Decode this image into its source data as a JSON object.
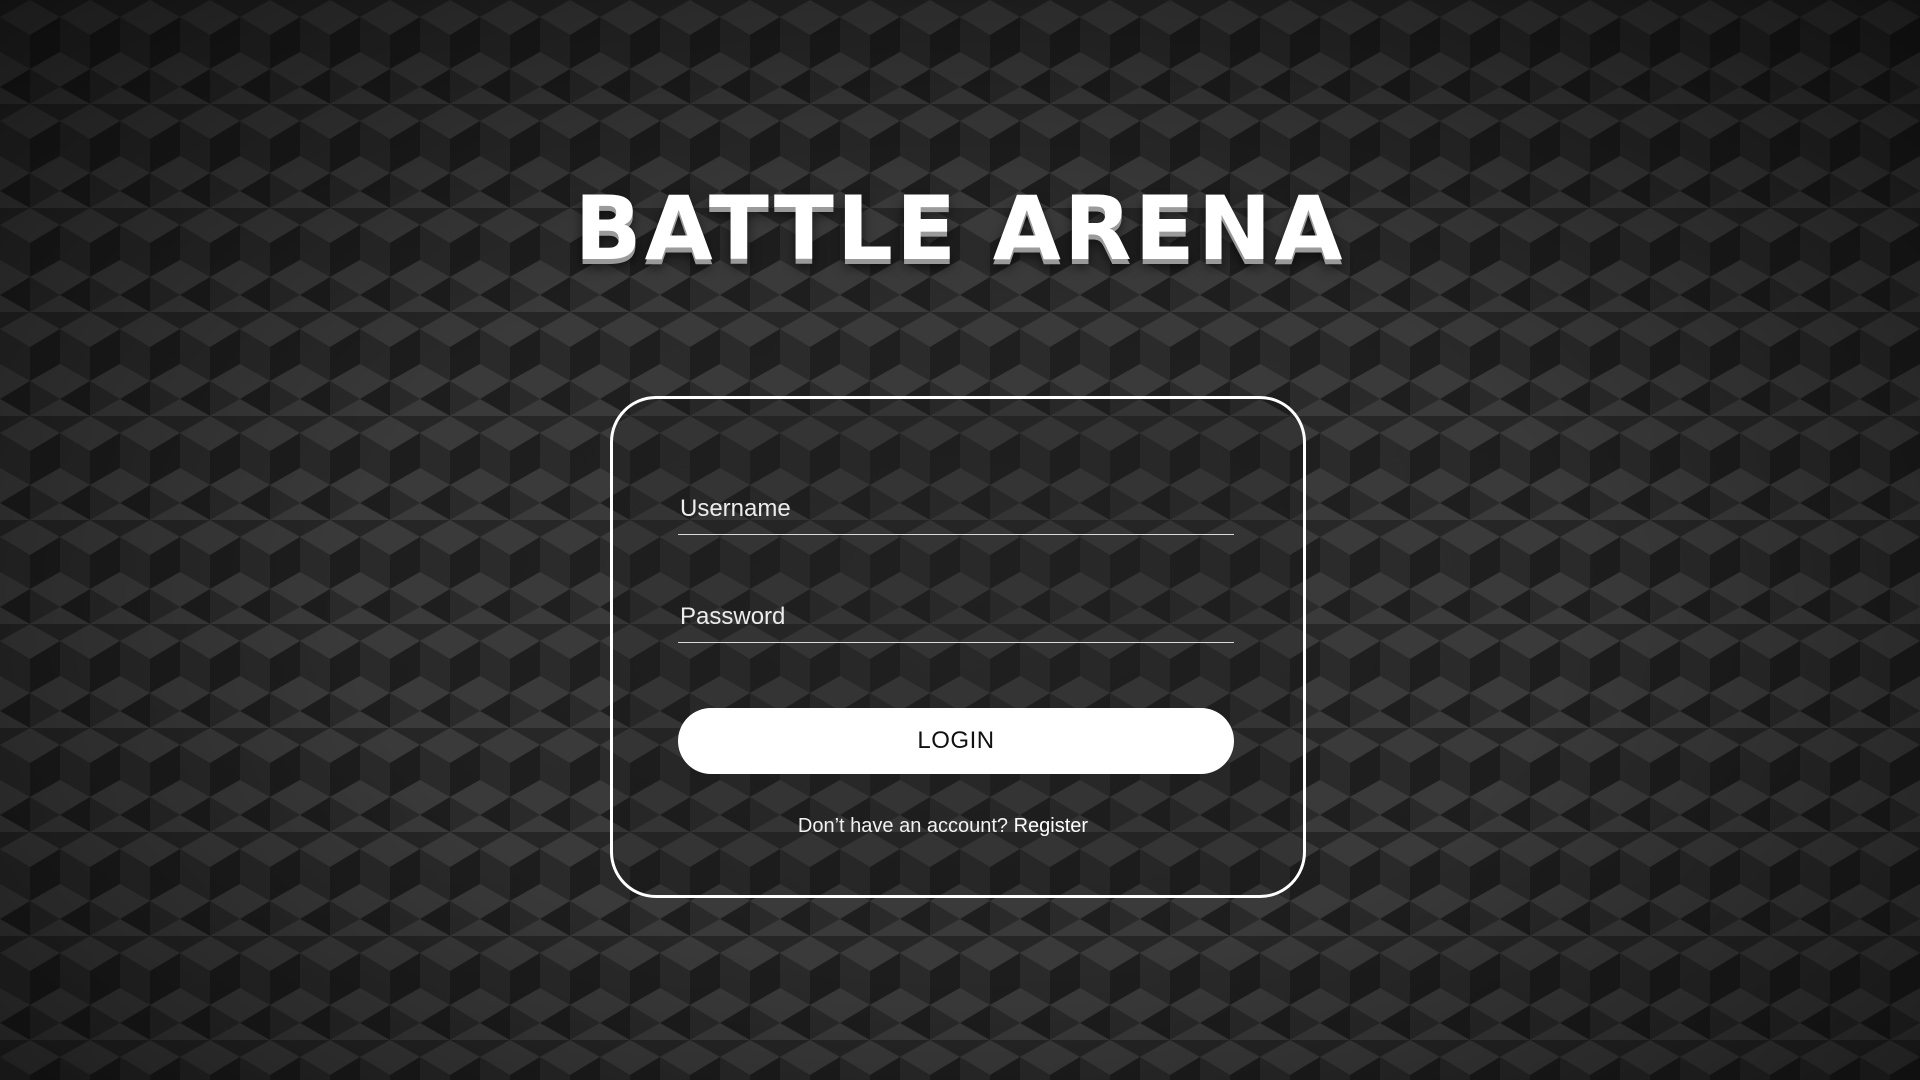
{
  "app": {
    "title": "BATTLE ARENA"
  },
  "login_form": {
    "username_placeholder": "Username",
    "username_value": "",
    "password_placeholder": "Password",
    "password_value": "",
    "login_label": "LOGIN",
    "register_prompt": "Don’t have an account?",
    "register_link": "Register"
  },
  "colors": {
    "background": "#262626",
    "panel_border": "#ffffff",
    "button_bg": "#ffffff",
    "button_text": "#111111",
    "text": "#ffffff"
  },
  "icons": {
    "background_pattern": "isometric-cube-pattern"
  }
}
